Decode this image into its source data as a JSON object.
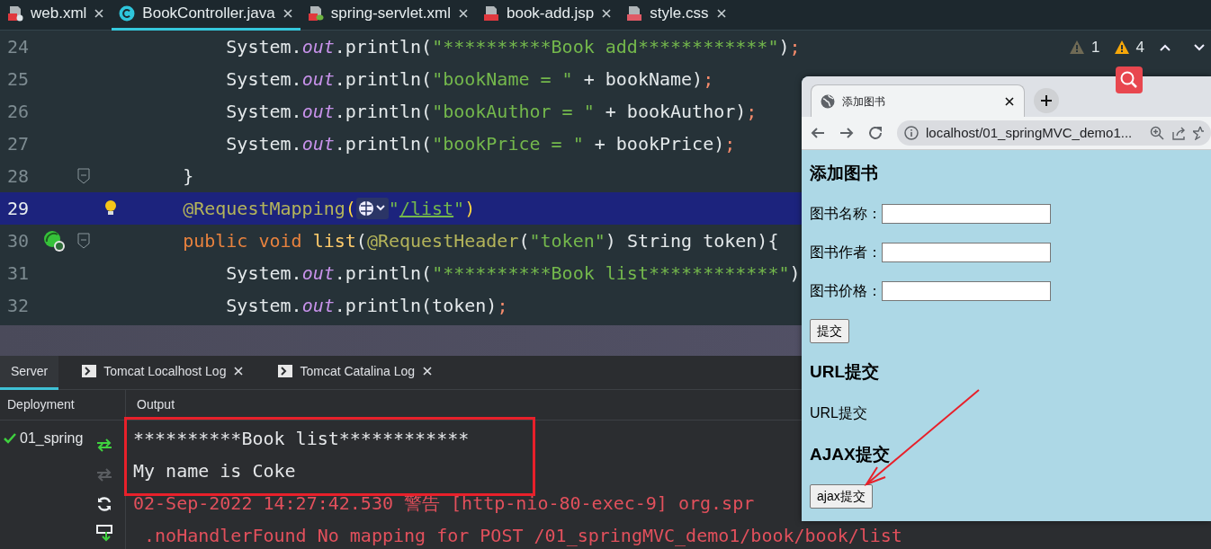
{
  "file_tabs": [
    {
      "label": "web.xml",
      "kind": "xml-web",
      "selected": false
    },
    {
      "label": "BookController.java",
      "kind": "java-class",
      "selected": true
    },
    {
      "label": "spring-servlet.xml",
      "kind": "xml-spring",
      "selected": false
    },
    {
      "label": "book-add.jsp",
      "kind": "jsp",
      "selected": false
    },
    {
      "label": "style.css",
      "kind": "css",
      "selected": false
    }
  ],
  "inspections": [
    {
      "kind": "weak-warning",
      "count": "1"
    },
    {
      "kind": "warning",
      "count": "4"
    }
  ],
  "code_lines": [
    {
      "number": "24",
      "current": false,
      "tokens": [
        {
          "text": "        System.",
          "kind": "plain"
        },
        {
          "text": "out",
          "kind": "field"
        },
        {
          "text": ".println(",
          "kind": "plain"
        },
        {
          "text": "\"**********Book add************\"",
          "kind": "string"
        },
        {
          "text": ")",
          "kind": "plain"
        },
        {
          "text": ";",
          "kind": "punct"
        }
      ]
    },
    {
      "number": "25",
      "current": false,
      "tokens": [
        {
          "text": "        System.",
          "kind": "plain"
        },
        {
          "text": "out",
          "kind": "field"
        },
        {
          "text": ".println(",
          "kind": "plain"
        },
        {
          "text": "\"bookName = \"",
          "kind": "string"
        },
        {
          "text": " + bookName)",
          "kind": "plain"
        },
        {
          "text": ";",
          "kind": "punct"
        }
      ]
    },
    {
      "number": "26",
      "current": false,
      "tokens": [
        {
          "text": "        System.",
          "kind": "plain"
        },
        {
          "text": "out",
          "kind": "field"
        },
        {
          "text": ".println(",
          "kind": "plain"
        },
        {
          "text": "\"bookAuthor = \"",
          "kind": "string"
        },
        {
          "text": " + bookAuthor)",
          "kind": "plain"
        },
        {
          "text": ";",
          "kind": "punct"
        }
      ]
    },
    {
      "number": "27",
      "current": false,
      "tokens": [
        {
          "text": "        System.",
          "kind": "plain"
        },
        {
          "text": "out",
          "kind": "field"
        },
        {
          "text": ".println(",
          "kind": "plain"
        },
        {
          "text": "\"bookPrice = \"",
          "kind": "string"
        },
        {
          "text": " + bookPrice)",
          "kind": "plain"
        },
        {
          "text": ";",
          "kind": "punct"
        }
      ]
    },
    {
      "number": "28",
      "current": false,
      "gutter": [
        {
          "kind": "fold"
        }
      ],
      "tokens": [
        {
          "text": "    }",
          "kind": "plain"
        }
      ]
    },
    {
      "number": "29",
      "current": true,
      "gutter": [
        {
          "kind": "bulb"
        }
      ],
      "tokens": [
        {
          "text": "    @RequestMapping",
          "kind": "annotation"
        },
        {
          "text": "(",
          "kind": "bracket"
        },
        {
          "kind": "inlay"
        },
        {
          "text": "\"",
          "kind": "string"
        },
        {
          "text": "/list",
          "kind": "link"
        },
        {
          "text": "\"",
          "kind": "string"
        },
        {
          "text": ")",
          "kind": "bracket"
        }
      ]
    },
    {
      "number": "30",
      "current": false,
      "gutter": [
        {
          "kind": "bean"
        },
        {
          "kind": "fold"
        }
      ],
      "tokens": [
        {
          "text": "    public void ",
          "kind": "keyword"
        },
        {
          "text": "list",
          "kind": "method"
        },
        {
          "text": "(",
          "kind": "plain"
        },
        {
          "text": "@RequestHeader",
          "kind": "annotation"
        },
        {
          "text": "(",
          "kind": "plain"
        },
        {
          "text": "\"token\"",
          "kind": "string"
        },
        {
          "text": ") String token){",
          "kind": "plain"
        }
      ]
    },
    {
      "number": "31",
      "current": false,
      "tokens": [
        {
          "text": "        System.",
          "kind": "plain"
        },
        {
          "text": "out",
          "kind": "field"
        },
        {
          "text": ".println(",
          "kind": "plain"
        },
        {
          "text": "\"**********Book list************\"",
          "kind": "string"
        },
        {
          "text": ")",
          "kind": "plain"
        }
      ]
    },
    {
      "number": "32",
      "current": false,
      "tokens": [
        {
          "text": "        System.",
          "kind": "plain"
        },
        {
          "text": "out",
          "kind": "field"
        },
        {
          "text": ".println(token)",
          "kind": "plain"
        },
        {
          "text": ";",
          "kind": "punct"
        }
      ]
    }
  ],
  "bottom_panel": {
    "tabs": [
      {
        "label": "Server",
        "kind": "plain",
        "selected": true,
        "closable": false
      },
      {
        "label": "Tomcat Localhost Log",
        "kind": "log",
        "selected": false,
        "closable": true
      },
      {
        "label": "Tomcat Catalina Log",
        "kind": "log",
        "selected": false,
        "closable": true
      }
    ],
    "columns": [
      "Deployment",
      "Output"
    ],
    "deployments": [
      {
        "label": "01_spring",
        "deployed": true
      }
    ],
    "actions": [
      {
        "kind": "redeploy",
        "disabled": false
      },
      {
        "kind": "undeploy",
        "disabled": true
      },
      {
        "kind": "refresh",
        "disabled": false
      },
      {
        "kind": "deploy-down",
        "disabled": false
      }
    ],
    "output": [
      {
        "text": "**********Book list************",
        "kind": "stdout"
      },
      {
        "text": "My name is Coke",
        "kind": "stdout"
      },
      {
        "text": "02-Sep-2022 14:27:42.530 警告 [http-nio-80-exec-9] org.spr",
        "kind": "error"
      },
      {
        "text": " .noHandlerFound No mapping for POST /01_springMVC_demo1/book/book/list",
        "kind": "error"
      }
    ]
  },
  "browser": {
    "tab_title": "添加图书",
    "url": "localhost/01_springMVC_demo1...",
    "page": [
      {
        "kind": "heading",
        "text": "添加图书"
      },
      {
        "kind": "field",
        "label": "图书名称："
      },
      {
        "kind": "field",
        "label": "图书作者："
      },
      {
        "kind": "field",
        "label": "图书价格："
      },
      {
        "kind": "button",
        "text": "提交"
      },
      {
        "kind": "heading",
        "text": "URL提交"
      },
      {
        "kind": "text",
        "text": "URL提交"
      },
      {
        "kind": "heading",
        "text": "AJAX提交"
      },
      {
        "kind": "button",
        "text": "ajax提交"
      }
    ]
  },
  "annotations": [
    {
      "kind": "box"
    },
    {
      "kind": "arrow"
    }
  ]
}
